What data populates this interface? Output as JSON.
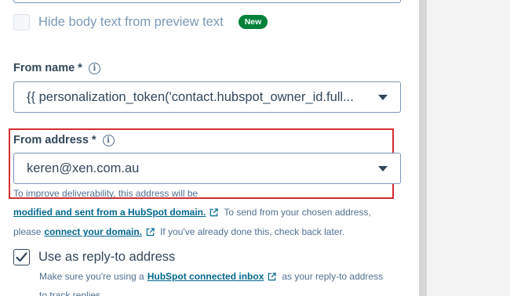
{
  "preview": {
    "hide_label": "Hide body text from preview text",
    "new_badge": "New"
  },
  "from_name": {
    "label": "From name *",
    "value": "{{ personalization_token('contact.hubspot_owner_id.full..."
  },
  "from_address": {
    "label": "From address *",
    "value": "keren@xen.com.au",
    "help_line1": "To improve deliverability, this address will be",
    "help_link1": "modified and sent from a HubSpot domain.",
    "help_text2": "To send from your chosen address,",
    "help_prefix3": "please",
    "help_link2": "connect your domain.",
    "help_text3": "If you've already done this, check back later."
  },
  "reply_to": {
    "label": "Use as reply-to address",
    "checked": true,
    "help_prefix": "Make sure you're using a",
    "help_link": "HubSpot connected inbox",
    "help_suffix": "as your reply-to address",
    "help_line2": "to track replies."
  },
  "colors": {
    "link": "#00688f",
    "highlight_border": "#d32f2f",
    "badge": "#00823a",
    "text": "#33475b"
  },
  "icons": [
    "info-icon",
    "external-link-icon",
    "checkmark-icon",
    "caret-down-icon"
  ]
}
